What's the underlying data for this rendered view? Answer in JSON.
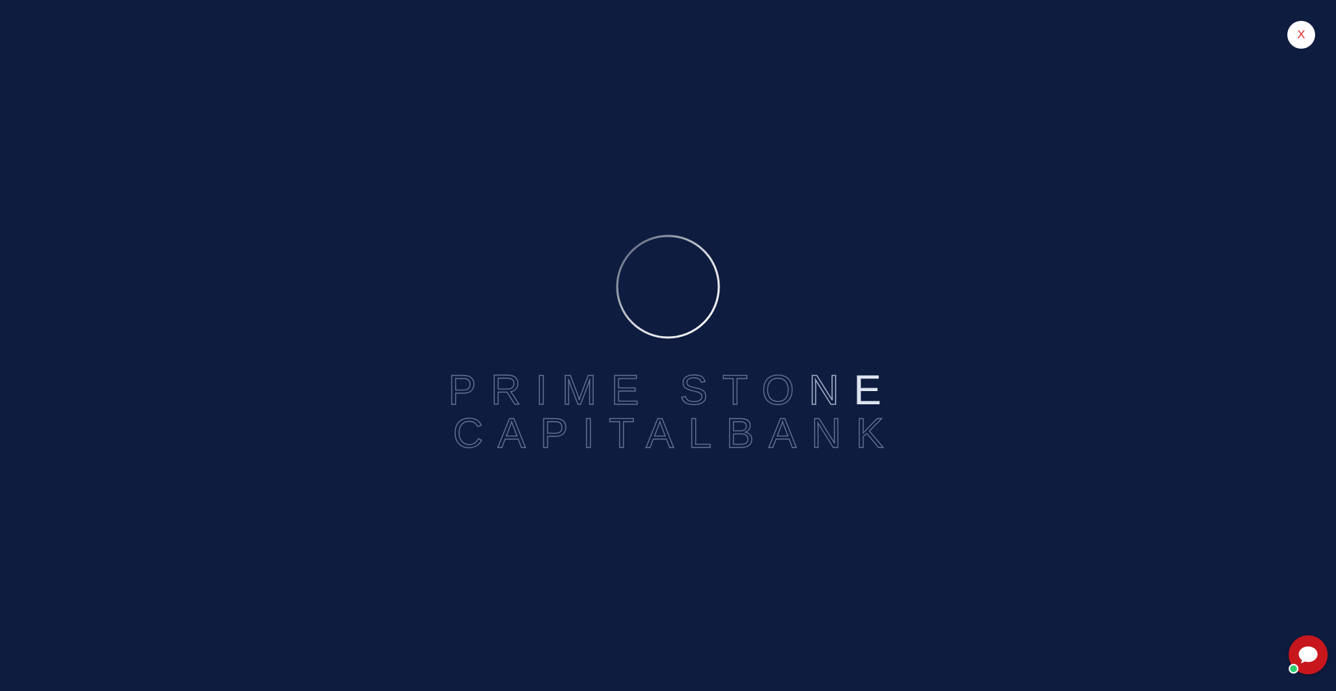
{
  "overlay": {
    "close_label": "X"
  },
  "brand": {
    "line1": [
      "P",
      "R",
      "I",
      "M",
      "E",
      " ",
      "S",
      "T",
      "O",
      "N",
      "E"
    ],
    "line2": [
      "C",
      "A",
      "P",
      "I",
      "T",
      "A",
      "L",
      "B",
      "A",
      "N",
      "K"
    ]
  },
  "icons": {
    "loader": "loading-spinner-icon",
    "chat": "chat-bubble-icon",
    "status": "online-status-icon"
  },
  "colors": {
    "background": "#0e1c3f",
    "close_text": "#e3262a",
    "chat_button": "#c8161d",
    "online": "#2ecc71"
  }
}
